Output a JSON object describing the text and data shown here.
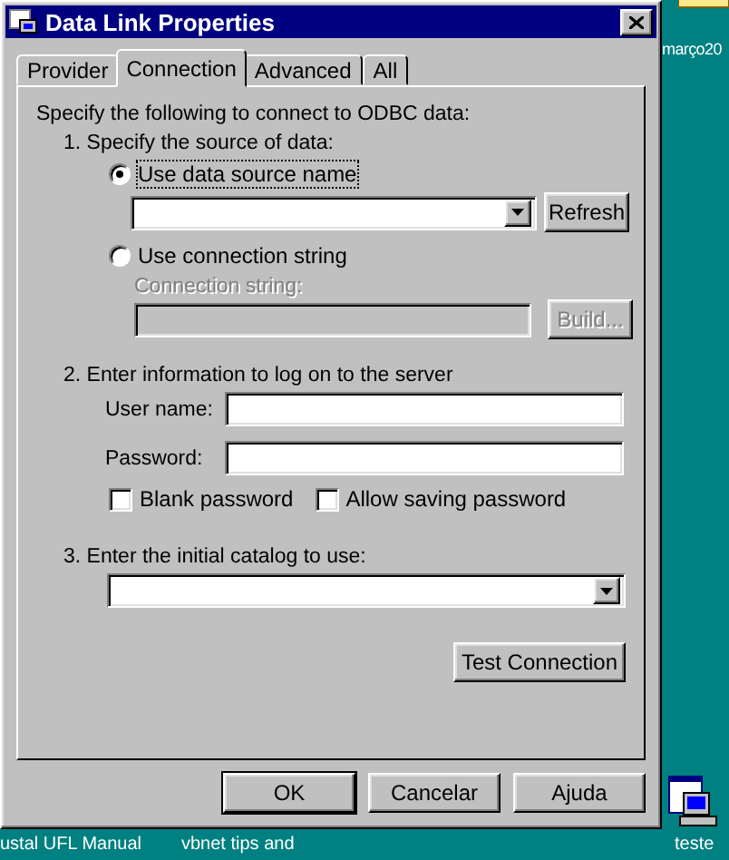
{
  "window": {
    "title": "Data Link Properties"
  },
  "tabs": [
    {
      "label": "Provider",
      "selected": false
    },
    {
      "label": "Connection",
      "selected": true
    },
    {
      "label": "Advanced",
      "selected": false
    },
    {
      "label": "All",
      "selected": false
    }
  ],
  "intro": "Specify the following to connect to ODBC data:",
  "step_1": {
    "heading": "1. Specify the source of data:",
    "options": [
      {
        "label": "Use data source name",
        "selected": true
      },
      {
        "label": "Use connection string",
        "selected": false
      }
    ],
    "refresh_button": "Refresh",
    "connection_string": {
      "label": "Connection string:",
      "disabled": true
    },
    "build_button": "Build..."
  },
  "step_2": {
    "heading": "2. Enter information to log on to the server",
    "user_name_label": "User name:",
    "password_label": "Password:",
    "checkboxes": [
      {
        "label": "Blank password",
        "checked": false
      },
      {
        "label": "Allow saving password",
        "checked": false
      }
    ]
  },
  "step_3": {
    "heading": "3. Enter the initial catalog to use:"
  },
  "test_button": "Test Connection",
  "buttons": [
    "OK",
    "Cancelar",
    "Ajuda"
  ],
  "desktop": {
    "icons": [
      {
        "label": "março20"
      },
      {
        "label": "ustal UFL Manual"
      },
      {
        "label": "vbnet tips and"
      },
      {
        "label": "teste"
      }
    ]
  }
}
